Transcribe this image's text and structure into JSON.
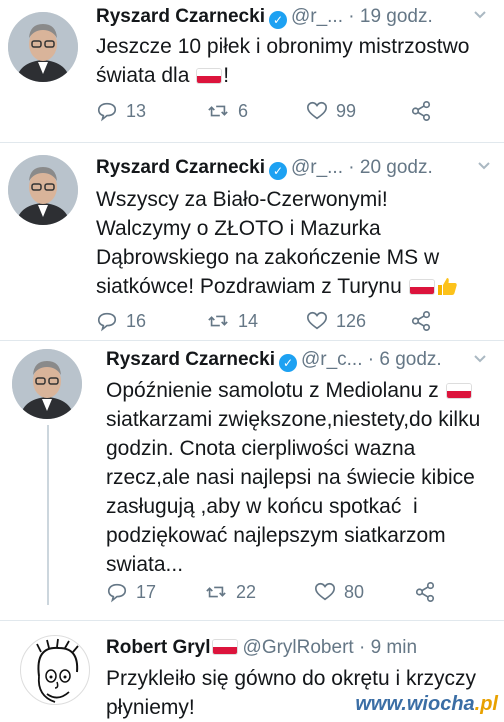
{
  "tweets": [
    {
      "name": "Ryszard Czarnecki",
      "handle": "@r_...",
      "time": "19 godz.",
      "text_1": "Jeszcze 10 piłek i obronimy mistrzostwo",
      "text_2a": "świata dla",
      "text_2b": "!",
      "replies": "13",
      "retweets": "6",
      "likes": "99"
    },
    {
      "name": "Ryszard Czarnecki",
      "handle": "@r_...",
      "time": "20 godz.",
      "text_1": "Wszyscy za Biało-Czerwonymi!",
      "text_2": "Walczymy o ZŁOTO i Mazurka",
      "text_3": "Dąbrowskiego na zakończenie MS w",
      "text_4": "siatkówce! Pozdrawiam z Turynu",
      "replies": "16",
      "retweets": "14",
      "likes": "126"
    },
    {
      "name": "Ryszard Czarnecki",
      "handle": "@r_c...",
      "time": "6 godz.",
      "text_1": "Opóźnienie samolotu z Mediolanu z",
      "text_2": "siatkarzami zwiększone,niestety,do kilku",
      "text_3": "godzin. Cnota cierpliwości wazna",
      "text_4": "rzecz,ale nasi najlepsi na świecie kibice",
      "text_5": "zasługują ,aby w końcu spotkać  i",
      "text_6": "podziękować najlepszym siatkarzom",
      "text_7": "swiata...",
      "replies": "17",
      "retweets": "22",
      "likes": "80"
    },
    {
      "name": "Robert Gryl",
      "handle": "@GrylRobert",
      "time": "9 min",
      "text_1": "Przykleiło się gówno do okrętu i krzyczy",
      "text_2": "płyniemy!"
    }
  ],
  "separator_dot": "·",
  "watermark": {
    "main": "www.wiocha",
    "tld": ".pl"
  },
  "colors": {
    "accent": "#1da1f2",
    "muted": "#657786",
    "flag_red": "#dc143c"
  }
}
